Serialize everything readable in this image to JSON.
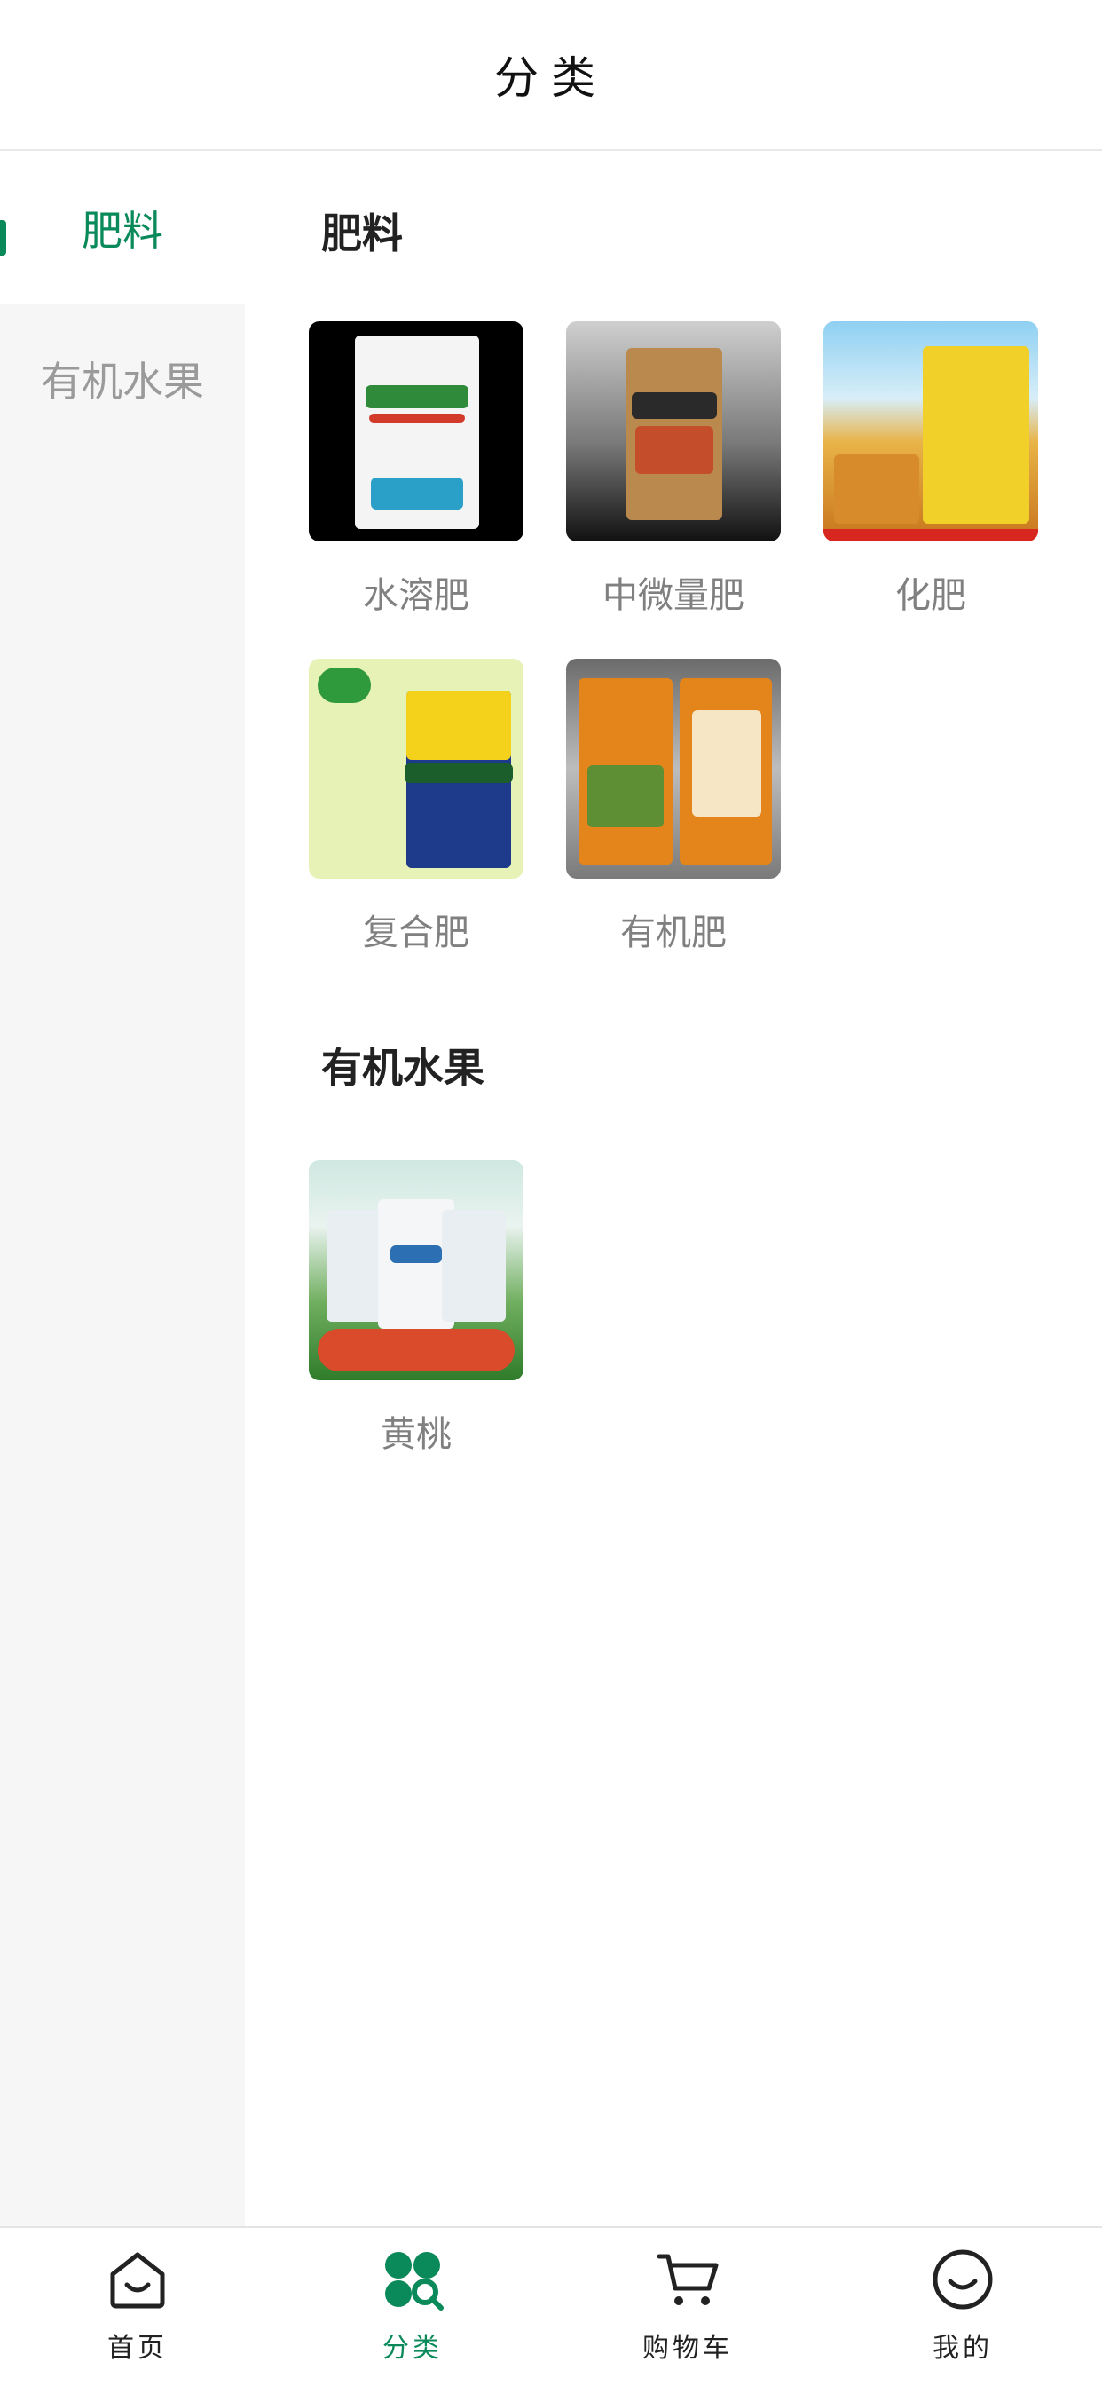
{
  "header": {
    "title": "分类"
  },
  "sidebar": {
    "items": [
      {
        "label": "肥料",
        "active": true
      },
      {
        "label": "有机水果",
        "active": false
      }
    ]
  },
  "sections": [
    {
      "title": "肥料",
      "items": [
        {
          "label": "水溶肥"
        },
        {
          "label": "中微量肥"
        },
        {
          "label": "化肥"
        },
        {
          "label": "复合肥"
        },
        {
          "label": "有机肥"
        }
      ]
    },
    {
      "title": "有机水果",
      "items": [
        {
          "label": "黄桃"
        }
      ]
    }
  ],
  "tabbar": {
    "items": [
      {
        "label": "首页",
        "icon": "home-icon"
      },
      {
        "label": "分类",
        "icon": "category-icon",
        "active": true
      },
      {
        "label": "购物车",
        "icon": "cart-icon"
      },
      {
        "label": "我的",
        "icon": "profile-icon"
      }
    ]
  },
  "colors": {
    "accent": "#0a8a5a",
    "sidebar_bg": "#f6f6f6"
  }
}
